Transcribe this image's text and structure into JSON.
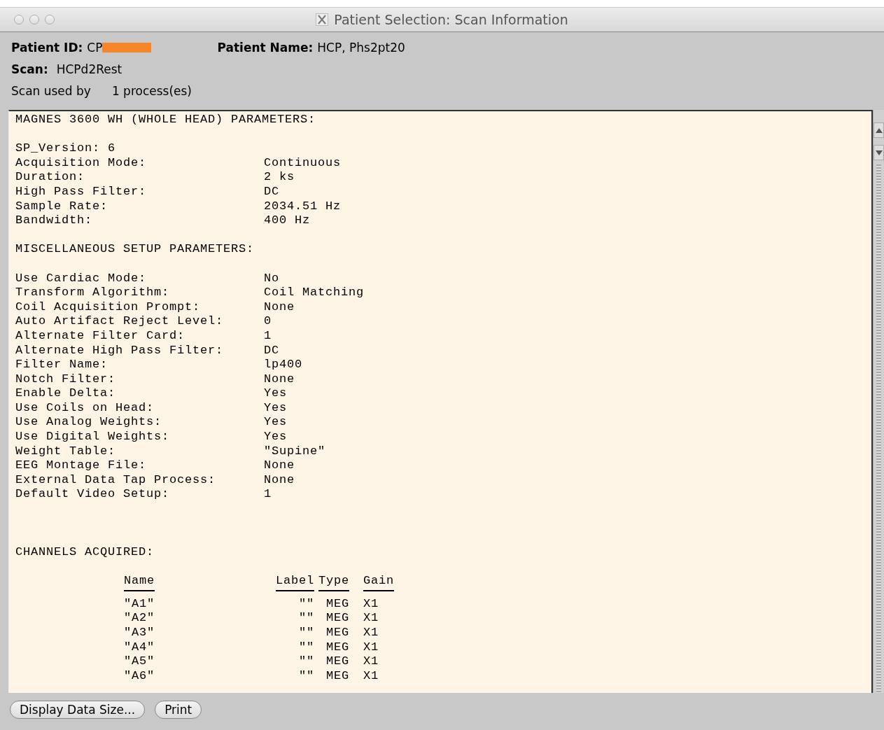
{
  "window": {
    "title": "Patient Selection: Scan Information"
  },
  "header": {
    "patient_id_label": "Patient ID:",
    "patient_id_value": "CP",
    "patient_id_redacted": true,
    "patient_name_label": "Patient Name:",
    "patient_name_value": "HCP, Phs2pt20",
    "scan_label": "Scan:",
    "scan_value": "HCPd2Rest",
    "used_by_label": "Scan used by",
    "used_by_value": "1 process(es)"
  },
  "sections": [
    {
      "heading": "MAGNES 3600 WH (WHOLE HEAD) PARAMETERS:",
      "rows": [
        {
          "kind": "inline",
          "label": "SP_Version:",
          "value": "6"
        },
        {
          "kind": "param",
          "label": "Acquisition Mode:",
          "value": "Continuous"
        },
        {
          "kind": "param",
          "label": "Duration:",
          "value": "2 ks"
        },
        {
          "kind": "param",
          "label": "High Pass Filter:",
          "value": "DC"
        },
        {
          "kind": "param",
          "label": "Sample Rate:",
          "value": "2034.51 Hz"
        },
        {
          "kind": "param",
          "label": "Bandwidth:",
          "value": "400 Hz"
        }
      ]
    },
    {
      "heading": "MISCELLANEOUS SETUP PARAMETERS:",
      "rows": [
        {
          "kind": "param",
          "label": "Use Cardiac Mode:",
          "value": "No"
        },
        {
          "kind": "param",
          "label": "Transform Algorithm:",
          "value": "Coil Matching"
        },
        {
          "kind": "param",
          "label": "Coil Acquisition Prompt:",
          "value": "None"
        },
        {
          "kind": "param",
          "label": "Auto Artifact Reject Level:",
          "value": "0"
        },
        {
          "kind": "param",
          "label": "Alternate Filter Card:",
          "value": "1"
        },
        {
          "kind": "param",
          "label": "Alternate High Pass Filter:",
          "value": "DC"
        },
        {
          "kind": "param",
          "label": "Filter Name:",
          "value": "lp400"
        },
        {
          "kind": "param",
          "label": "Notch Filter:",
          "value": "None"
        },
        {
          "kind": "param",
          "label": "Enable Delta:",
          "value": "Yes"
        },
        {
          "kind": "param",
          "label": "Use Coils on Head:",
          "value": "Yes"
        },
        {
          "kind": "param",
          "label": "Use Analog Weights:",
          "value": "Yes"
        },
        {
          "kind": "param",
          "label": "Use Digital Weights:",
          "value": "Yes"
        },
        {
          "kind": "param",
          "label": "Weight Table:",
          "value": "\"Supine\""
        },
        {
          "kind": "param",
          "label": "EEG Montage File:",
          "value": "None"
        },
        {
          "kind": "param",
          "label": "External Data Tap Process:",
          "value": "None"
        },
        {
          "kind": "param",
          "label": "Default Video Setup:",
          "value": "1"
        }
      ]
    }
  ],
  "channels": {
    "heading": "CHANNELS ACQUIRED:",
    "columns": [
      "Name",
      "Label",
      "Type",
      "Gain"
    ],
    "rows": [
      [
        "\"A1\"",
        "\"\"",
        "MEG",
        "X1"
      ],
      [
        "\"A2\"",
        "\"\"",
        "MEG",
        "X1"
      ],
      [
        "\"A3\"",
        "\"\"",
        "MEG",
        "X1"
      ],
      [
        "\"A4\"",
        "\"\"",
        "MEG",
        "X1"
      ],
      [
        "\"A5\"",
        "\"\"",
        "MEG",
        "X1"
      ],
      [
        "\"A6\"",
        "\"\"",
        "MEG",
        "X1"
      ]
    ]
  },
  "buttons": [
    "Display Data Size...",
    "Print"
  ]
}
